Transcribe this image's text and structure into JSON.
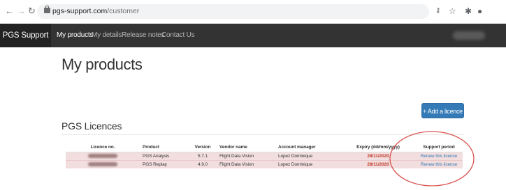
{
  "browser": {
    "url_host": "pgs-support.com",
    "url_path": "/customer",
    "icons": [
      "back-arrow",
      "forward-arrow",
      "reload",
      "lock",
      "key",
      "star",
      "puzzle",
      "profile"
    ]
  },
  "navbar": {
    "brand": "PGS Support",
    "links": [
      "My products",
      "My details",
      "Release notes",
      "Contact Us"
    ]
  },
  "page": {
    "title": "My products",
    "add_button": "+ Add a licence",
    "section_title": "PGS Licences"
  },
  "table": {
    "headers": [
      "Licence no.",
      "Product",
      "Version",
      "Vendor name",
      "Account manager",
      "Expiry (dd/mm/yyyy)",
      "Support period"
    ],
    "rows": [
      {
        "product": "PGS Analysis",
        "version": "5.7.1",
        "vendor": "Flight Data Vision",
        "manager": "Lopez Dominique",
        "expiry": "28/11/2020",
        "support": "Renew this licence"
      },
      {
        "product": "PGS Replay",
        "version": "4.9.0",
        "vendor": "Flight Data Vision",
        "manager": "Lopez Dominique",
        "expiry": "28/11/2020",
        "support": "Renew this licence"
      }
    ]
  },
  "colors": {
    "navbar_bg": "#333333",
    "brand_bg": "#222222",
    "primary": "#337ab7",
    "row_highlight": "#f2dede",
    "expiry_text": "#c0392b",
    "annotation": "#d9534f"
  }
}
